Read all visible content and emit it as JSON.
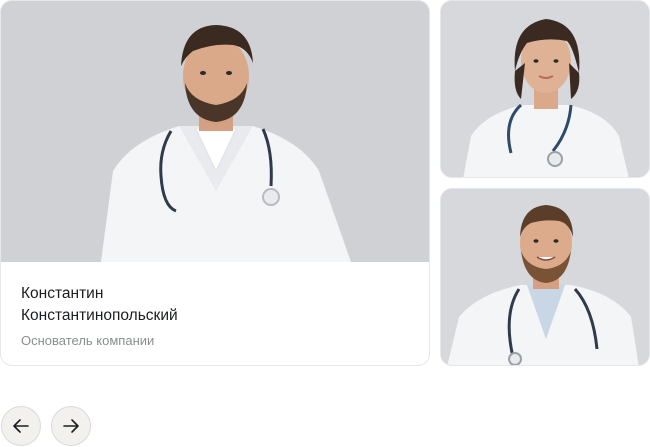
{
  "featured": {
    "name_line1": "Константин",
    "name_line2": "Константинопольский",
    "role": "Основатель компании",
    "photo": "male-doctor-photo"
  },
  "side_cards": [
    {
      "photo": "female-doctor-photo"
    },
    {
      "photo": "smiling-male-doctor-photo"
    }
  ],
  "nav": {
    "prev_icon": "arrow-left-icon",
    "next_icon": "arrow-right-icon"
  },
  "colors": {
    "photo_bg": "#cfd1d5",
    "coat": "#f4f5f7",
    "hair_dark": "#3a2a20",
    "skin": "#d9a98a",
    "stethoscope": "#2f3a4a",
    "text_primary": "#1b1d22",
    "text_secondary": "#8a8d94",
    "nav_bg": "#f3f1ee"
  }
}
